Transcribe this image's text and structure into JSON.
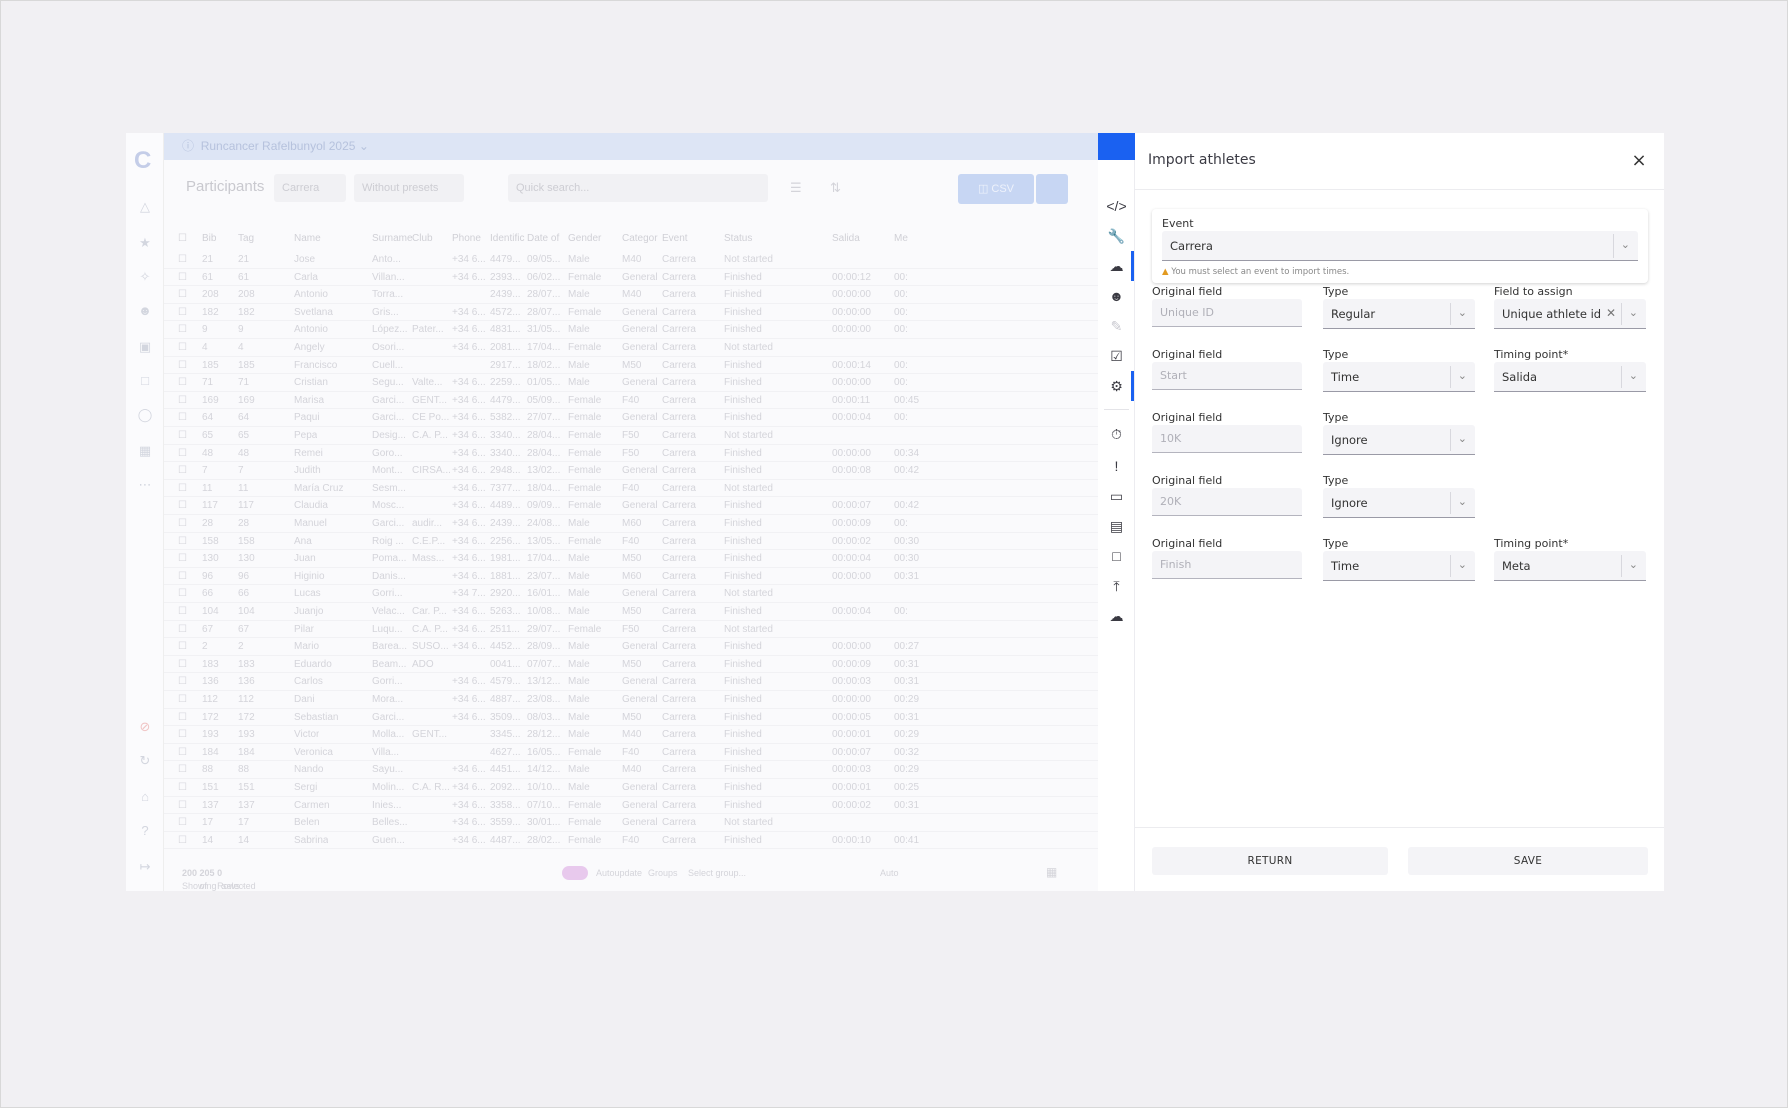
{
  "background_app": {
    "title": "Runcancer Rafelbunyol 2025",
    "page_title": "Participants",
    "event_filter": "Carrera",
    "preset_filter": "Without presets",
    "search_placeholder": "Quick search...",
    "csv_label": "CSV",
    "columns": [
      "Bib",
      "Tag",
      "Name",
      "Surname",
      "Club",
      "Phone",
      "Identific",
      "Date of",
      "Gender",
      "Categor",
      "Event",
      "Status",
      "Salida",
      "Me"
    ],
    "rows": [
      [
        "21",
        "21",
        "Jose",
        "Anto...",
        "",
        "+34 6...",
        "4479...",
        "09/05...",
        "Male",
        "M40",
        "Carrera",
        "Not started",
        "",
        ""
      ],
      [
        "61",
        "61",
        "Carla",
        "Villan...",
        "",
        "+34 6...",
        "2393...",
        "06/02...",
        "Female",
        "General",
        "Carrera",
        "Finished",
        "00:00:12",
        "00:"
      ],
      [
        "208",
        "208",
        "Antonio",
        "Torra...",
        "",
        "",
        "2439...",
        "28/07...",
        "Male",
        "M40",
        "Carrera",
        "Finished",
        "00:00:00",
        "00:"
      ],
      [
        "182",
        "182",
        "Svetlana",
        "Gris...",
        "",
        "+34 6...",
        "4572...",
        "28/07...",
        "Female",
        "General",
        "Carrera",
        "Finished",
        "00:00:00",
        "00:"
      ],
      [
        "9",
        "9",
        "Antonio",
        "López...",
        "Pater...",
        "+34 6...",
        "4831...",
        "31/05...",
        "Male",
        "General",
        "Carrera",
        "Finished",
        "00:00:00",
        "00:"
      ],
      [
        "4",
        "4",
        "Angely",
        "Osori...",
        "",
        "+34 6...",
        "2081...",
        "17/04...",
        "Female",
        "General",
        "Carrera",
        "Not started",
        "",
        ""
      ],
      [
        "185",
        "185",
        "Francisco",
        "Cuell...",
        "",
        "",
        "2917...",
        "18/02...",
        "Male",
        "M50",
        "Carrera",
        "Finished",
        "00:00:14",
        "00:"
      ],
      [
        "71",
        "71",
        "Cristian",
        "Segu...",
        "Valte...",
        "+34 6...",
        "2259...",
        "01/05...",
        "Male",
        "General",
        "Carrera",
        "Finished",
        "00:00:00",
        "00:"
      ],
      [
        "169",
        "169",
        "Marisa",
        "Garci...",
        "GENT...",
        "+34 6...",
        "4479...",
        "05/09...",
        "Female",
        "F40",
        "Carrera",
        "Finished",
        "00:00:11",
        "00:45"
      ],
      [
        "64",
        "64",
        "Paqui",
        "Garci...",
        "CE Po...",
        "+34 6...",
        "5382...",
        "27/07...",
        "Female",
        "General",
        "Carrera",
        "Finished",
        "00:00:04",
        "00:"
      ],
      [
        "65",
        "65",
        "Pepa",
        "Desig...",
        "C.A. P...",
        "+34 6...",
        "3340...",
        "28/04...",
        "Female",
        "F50",
        "Carrera",
        "Not started",
        "",
        ""
      ],
      [
        "48",
        "48",
        "Remei",
        "Goro...",
        "",
        "+34 6...",
        "3340...",
        "28/04...",
        "Female",
        "F50",
        "Carrera",
        "Finished",
        "00:00:00",
        "00:34"
      ],
      [
        "7",
        "7",
        "Judith",
        "Mont...",
        "CIRSA...",
        "+34 6...",
        "2948...",
        "13/02...",
        "Female",
        "General",
        "Carrera",
        "Finished",
        "00:00:08",
        "00:42"
      ],
      [
        "11",
        "11",
        "María Cruz",
        "Sesm...",
        "",
        "+34 6...",
        "7377...",
        "18/04...",
        "Female",
        "F40",
        "Carrera",
        "Not started",
        "",
        ""
      ],
      [
        "117",
        "117",
        "Claudia",
        "Mosc...",
        "",
        "+34 6...",
        "4489...",
        "09/09...",
        "Female",
        "General",
        "Carrera",
        "Finished",
        "00:00:07",
        "00:42"
      ],
      [
        "28",
        "28",
        "Manuel",
        "Garci...",
        "audir...",
        "+34 6...",
        "2439...",
        "24/08...",
        "Male",
        "M60",
        "Carrera",
        "Finished",
        "00:00:09",
        "00:"
      ],
      [
        "158",
        "158",
        "Ana",
        "Roig ...",
        "C.E.P...",
        "+34 6...",
        "2256...",
        "13/05...",
        "Female",
        "F40",
        "Carrera",
        "Finished",
        "00:00:02",
        "00:30"
      ],
      [
        "130",
        "130",
        "Juan",
        "Poma...",
        "Mass...",
        "+34 6...",
        "1981...",
        "17/04...",
        "Male",
        "M50",
        "Carrera",
        "Finished",
        "00:00:04",
        "00:30"
      ],
      [
        "96",
        "96",
        "Higinio",
        "Danis...",
        "",
        "+34 6...",
        "1881...",
        "23/07...",
        "Male",
        "M60",
        "Carrera",
        "Finished",
        "00:00:00",
        "00:31"
      ],
      [
        "66",
        "66",
        "Lucas",
        "Gorri...",
        "",
        "+34 7...",
        "2920...",
        "16/01...",
        "Male",
        "General",
        "Carrera",
        "Not started",
        "",
        ""
      ],
      [
        "104",
        "104",
        "Juanjo",
        "Velac...",
        "Car. P...",
        "+34 6...",
        "5263...",
        "10/08...",
        "Male",
        "M50",
        "Carrera",
        "Finished",
        "00:00:04",
        "00:"
      ],
      [
        "67",
        "67",
        "Pilar",
        "Luqu...",
        "C.A. P...",
        "+34 6...",
        "2511...",
        "29/07...",
        "Female",
        "F50",
        "Carrera",
        "Not started",
        "",
        ""
      ],
      [
        "2",
        "2",
        "Mario",
        "Barea...",
        "SUSO...",
        "+34 6...",
        "4452...",
        "28/09...",
        "Male",
        "General",
        "Carrera",
        "Finished",
        "00:00:00",
        "00:27"
      ],
      [
        "183",
        "183",
        "Eduardo",
        "Beam...",
        "ADO",
        "",
        "0041...",
        "07/07...",
        "Male",
        "M50",
        "Carrera",
        "Finished",
        "00:00:09",
        "00:31"
      ],
      [
        "136",
        "136",
        "Carlos",
        "Gorri...",
        "",
        "+34 6...",
        "4579...",
        "13/12...",
        "Male",
        "General",
        "Carrera",
        "Finished",
        "00:00:03",
        "00:31"
      ],
      [
        "112",
        "112",
        "Dani",
        "Mora...",
        "",
        "+34 6...",
        "4887...",
        "23/08...",
        "Male",
        "General",
        "Carrera",
        "Finished",
        "00:00:00",
        "00:29"
      ],
      [
        "172",
        "172",
        "Sebastian",
        "Garci...",
        "",
        "+34 6...",
        "3509...",
        "08/03...",
        "Male",
        "M50",
        "Carrera",
        "Finished",
        "00:00:05",
        "00:31"
      ],
      [
        "193",
        "193",
        "Victor",
        "Molla...",
        "GENT...",
        "",
        "3345...",
        "28/12...",
        "Male",
        "M40",
        "Carrera",
        "Finished",
        "00:00:01",
        "00:29"
      ],
      [
        "184",
        "184",
        "Veronica",
        "Villa...",
        "",
        "",
        "4627...",
        "16/05...",
        "Female",
        "F40",
        "Carrera",
        "Finished",
        "00:00:07",
        "00:32"
      ],
      [
        "88",
        "88",
        "Nando",
        "Sayu...",
        "",
        "+34 6...",
        "4451...",
        "14/12...",
        "Male",
        "M40",
        "Carrera",
        "Finished",
        "00:00:03",
        "00:29"
      ],
      [
        "151",
        "151",
        "Sergi",
        "Molin...",
        "C.A. R...",
        "+34 6...",
        "2092...",
        "10/10...",
        "Male",
        "General",
        "Carrera",
        "Finished",
        "00:00:01",
        "00:25"
      ],
      [
        "137",
        "137",
        "Carmen",
        "Inies...",
        "",
        "+34 6...",
        "3358...",
        "07/10...",
        "Female",
        "General",
        "Carrera",
        "Finished",
        "00:00:02",
        "00:31"
      ],
      [
        "17",
        "17",
        "Belen",
        "Belles...",
        "",
        "+34 6...",
        "3559...",
        "30/01...",
        "Female",
        "General",
        "Carrera",
        "Not started",
        "",
        ""
      ],
      [
        "14",
        "14",
        "Sabrina",
        "Guen...",
        "",
        "+34 6...",
        "4487...",
        "28/02...",
        "Female",
        "F40",
        "Carrera",
        "Finished",
        "00:00:10",
        "00:41"
      ]
    ],
    "footer": {
      "showing_prefix": "Showing",
      "shown": "200",
      "of": "of",
      "total": "205",
      "rows_text": "Rows -",
      "selected": "0",
      "selected_suffix": "selected",
      "autoupdate": "Autoupdate",
      "groups_label": "Groups",
      "groups_placeholder": "Select group...",
      "size_label": "Auto"
    }
  },
  "sidebar_icons": [
    "code-icon",
    "wrench-icon",
    "cloud-download-icon",
    "user-plus-icon",
    "edit-icon",
    "clipboard-check-icon",
    "user-settings-icon",
    "stopwatch-icon",
    "alert-icon",
    "laptop-icon",
    "monitor-icon",
    "document-icon",
    "upload-icon",
    "cloud-upload-icon"
  ],
  "panel": {
    "title": "Import athletes",
    "close_glyph": "×",
    "event": {
      "label": "Event",
      "value": "Carrera",
      "warning": "You must select an event to import times."
    },
    "labels": {
      "original_field": "Original field",
      "type": "Type",
      "field_to_assign": "Field to assign",
      "timing_point": "Timing point*"
    },
    "mappings": [
      {
        "original": "Unique ID",
        "type": "Regular",
        "assign_label": "Field to assign",
        "assign_value": "Unique athlete id"
      },
      {
        "original": "Start",
        "type": "Time",
        "assign_label": "Timing point*",
        "assign_value": "Salida"
      },
      {
        "original": "10K",
        "type": "Ignore"
      },
      {
        "original": "20K",
        "type": "Ignore"
      },
      {
        "original": "Finish",
        "type": "Time",
        "assign_label": "Timing point*",
        "assign_value": "Meta"
      }
    ],
    "return_label": "RETURN",
    "save_label": "SAVE"
  },
  "colors": {
    "accent": "#1a61f1",
    "warning": "#e29a20"
  }
}
